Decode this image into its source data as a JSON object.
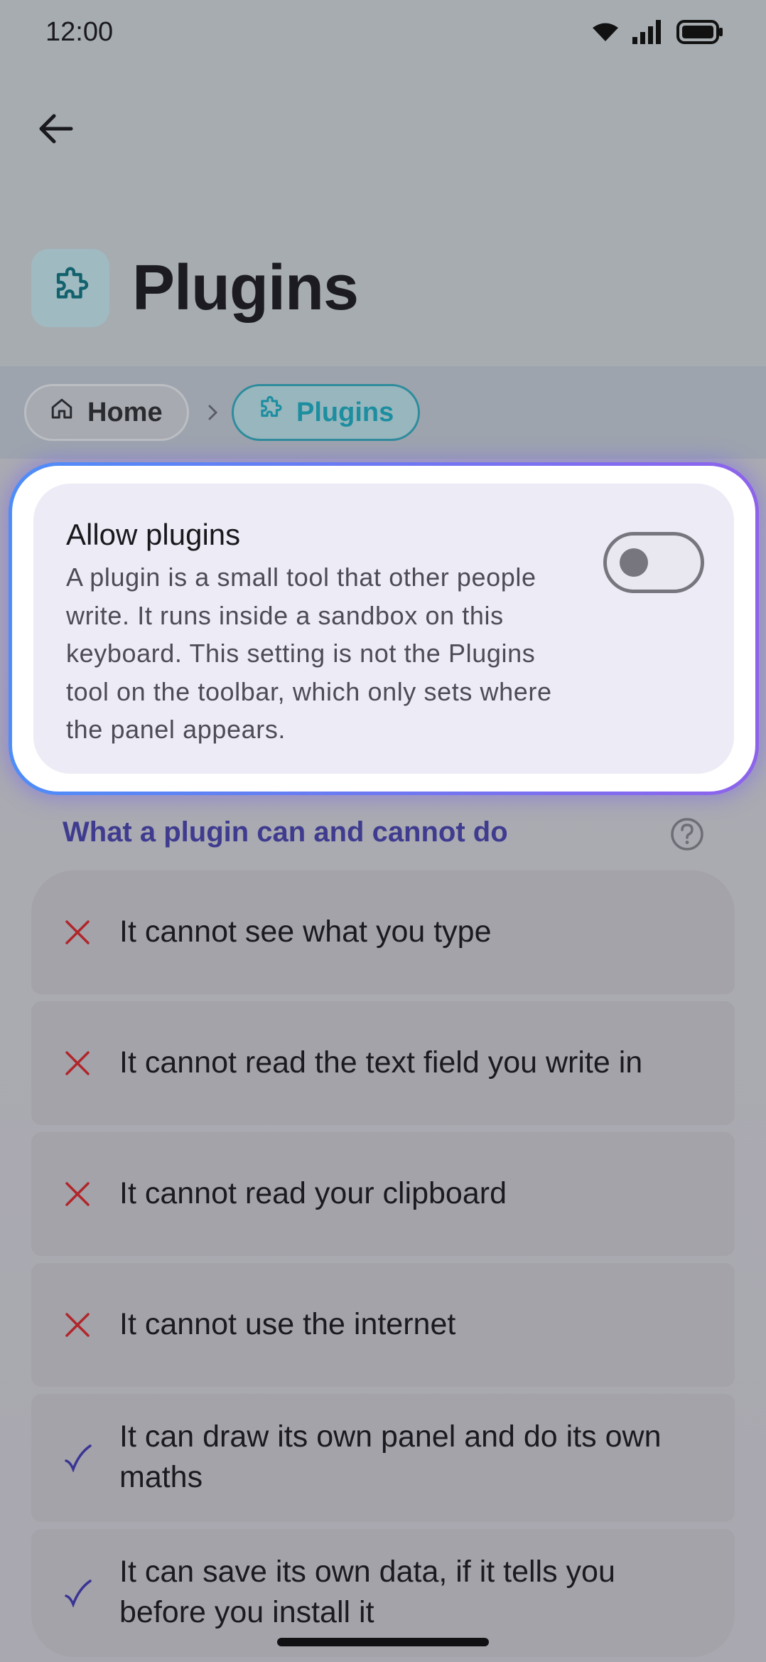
{
  "status_bar": {
    "time": "12:00",
    "icons": [
      "wifi-icon",
      "signal-icon",
      "battery-icon"
    ]
  },
  "header": {
    "back_icon": "arrow-left-icon",
    "title": "Plugins",
    "title_icon": "puzzle-icon"
  },
  "breadcrumb": {
    "items": [
      {
        "label": "Home",
        "icon": "home-icon"
      },
      {
        "label": "Plugins",
        "icon": "puzzle-icon"
      }
    ]
  },
  "allow_card": {
    "title": "Allow plugins",
    "description": "A plugin is a small tool that other people write. It runs inside a sandbox on this keyboard. This setting is not the Plugins tool on the toolbar, which only sets where the panel appears.",
    "toggle_on": false
  },
  "section": {
    "title": "What a plugin can and cannot do",
    "help_icon": "help-circle-icon"
  },
  "capabilities": [
    {
      "text": "It cannot see what you type",
      "allowed": false
    },
    {
      "text": "It cannot read the text field you write in",
      "allowed": false
    },
    {
      "text": "It cannot read your clipboard",
      "allowed": false
    },
    {
      "text": "It cannot use the internet",
      "allowed": false
    },
    {
      "text": "It can draw its own panel and do its own maths",
      "allowed": true
    },
    {
      "text": "It can save its own data, if it tells you before you install it",
      "allowed": true
    }
  ],
  "colors": {
    "accent": "#1c8ea0",
    "section_title": "#3f3c8f",
    "deny": "#b0262a",
    "allow": "#3a3594"
  }
}
